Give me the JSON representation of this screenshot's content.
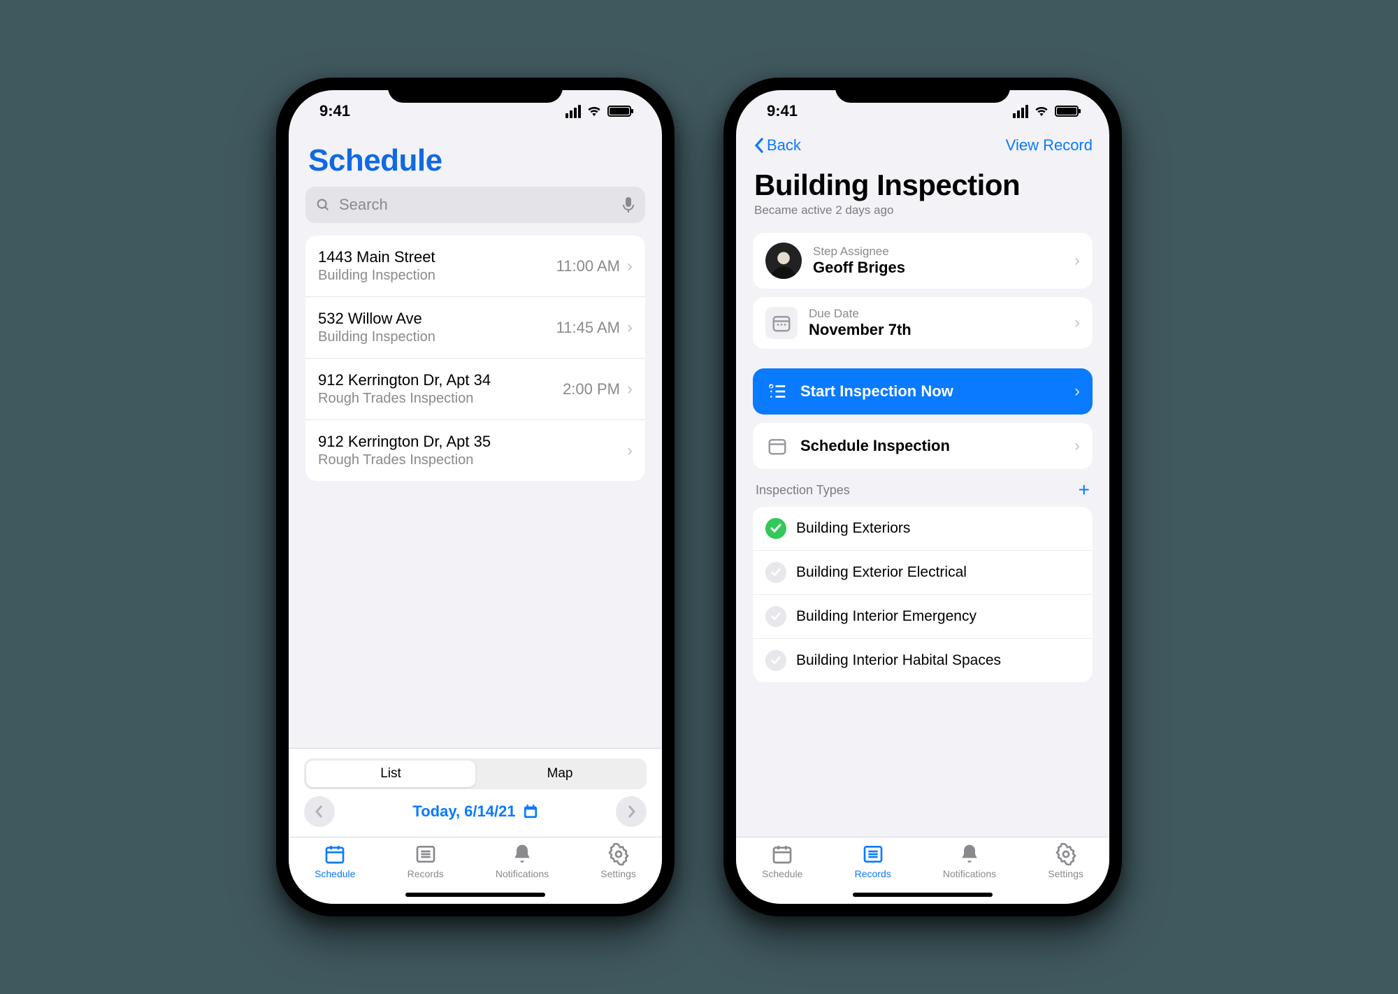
{
  "status_time": "9:41",
  "schedule": {
    "title": "Schedule",
    "search_placeholder": "Search",
    "items": [
      {
        "title": "1443 Main Street",
        "sub": "Building Inspection",
        "time": "11:00 AM"
      },
      {
        "title": "532 Willow Ave",
        "sub": "Building Inspection",
        "time": "11:45 AM"
      },
      {
        "title": "912 Kerrington Dr, Apt 34",
        "sub": "Rough Trades Inspection",
        "time": "2:00 PM"
      },
      {
        "title": "912 Kerrington Dr, Apt 35",
        "sub": "Rough Trades Inspection",
        "time": ""
      }
    ],
    "segment": {
      "options": [
        "List",
        "Map"
      ],
      "selected": 0
    },
    "date_label": "Today, 6/14/21"
  },
  "detail": {
    "back_label": "Back",
    "view_record_label": "View Record",
    "title": "Building Inspection",
    "subtitle": "Became active 2 days ago",
    "assignee_label": "Step Assignee",
    "assignee_name": "Geoff Briges",
    "due_label": "Due Date",
    "due_value": "November 7th",
    "start_label": "Start Inspection Now",
    "schedule_label": "Schedule Inspection",
    "types_header": "Inspection Types",
    "types": [
      {
        "name": "Building Exteriors",
        "done": true
      },
      {
        "name": "Building Exterior Electrical",
        "done": false
      },
      {
        "name": "Building Interior Emergency",
        "done": false
      },
      {
        "name": "Building Interior Habital Spaces",
        "done": false
      }
    ]
  },
  "tabs": {
    "schedule": "Schedule",
    "records": "Records",
    "notifications": "Notifications",
    "settings": "Settings"
  }
}
